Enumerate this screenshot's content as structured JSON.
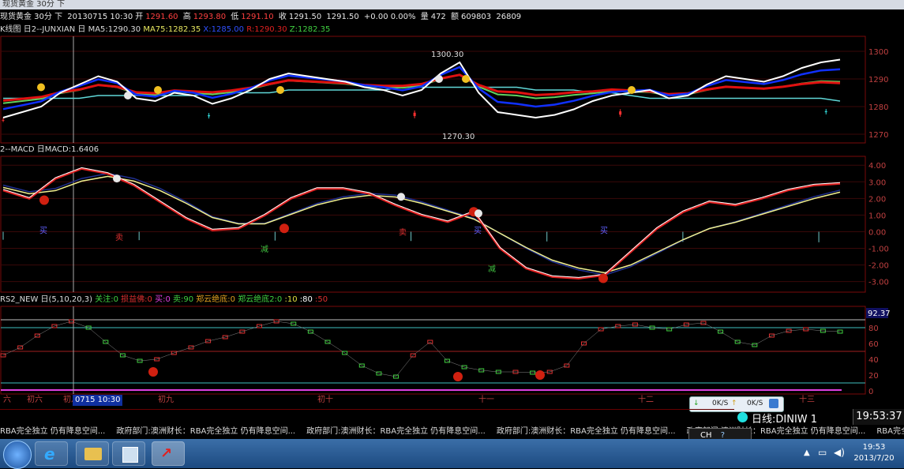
{
  "window": {
    "title": "现货黄金 30分 下"
  },
  "quote": {
    "symbol": "现货黄金 30分 下",
    "date": "20130715 10:30",
    "open_label": "开",
    "open": "1291.60",
    "high_label": "高",
    "high": "1293.80",
    "low_label": "低",
    "low": "1291.10",
    "close_label": "收",
    "close": "1291.50",
    "last": "1291.50",
    "change": "+0.00 0.00%",
    "vol_label": "量",
    "vol": "472",
    "amt_label": "额",
    "amt": "609803",
    "extra": "26809"
  },
  "pane_k": {
    "title": "K线图 日2--JUNXIAN 日",
    "ma5_label": "MA5:",
    "ma5": "1290.30",
    "ma75_label": "MA75:",
    "ma75": "1282.35",
    "x_label": "X:",
    "x": "1285.00",
    "r_label": "R:",
    "r": "1290.30",
    "z_label": "Z:",
    "z": "1282.35",
    "ann_high": "1300.30",
    "ann_low": "1270.30",
    "y_ticks": [
      "1300",
      "1290",
      "1280",
      "1270"
    ],
    "colors": {
      "up": "#ff3030",
      "down": "#30d0d0",
      "ma_white": "#ffffff",
      "ma_blue": "#1030ff",
      "ma_red": "#e01010",
      "ma_green": "#60d060",
      "ma_cyan": "#60d8d8"
    }
  },
  "pane_macd": {
    "title": "2--MACD 日",
    "macd_label": "MACD:",
    "macd": "1.6406",
    "y_ticks": [
      "4.00",
      "3.00",
      "2.00",
      "1.00",
      "0.00",
      "-1.00",
      "-2.00",
      "-3.00"
    ],
    "marks": [
      "买",
      "卖",
      "减",
      "卖",
      "减",
      "买",
      "买"
    ]
  },
  "pane_rs": {
    "title": "RS2_NEW 日(5,10,20,3)",
    "legend": [
      {
        "label": "关注:0",
        "color": "#40d040"
      },
      {
        "label": "损益佛:0",
        "color": "#e03030"
      },
      {
        "label": "买:0",
        "color": "#e040e0"
      },
      {
        "label": "卖:90",
        "color": "#40d040"
      },
      {
        "label": "郑云绝底:0",
        "color": "#e0a020"
      },
      {
        "label": "郑云绝底2:0",
        "color": "#40d040"
      },
      {
        "label": ":10",
        "color": "#e0e040"
      },
      {
        "label": ":80",
        "color": "#ffffff"
      },
      {
        "label": ":50",
        "color": "#e03030"
      }
    ],
    "y_ticks": [
      "80",
      "60",
      "40",
      "20",
      "0"
    ],
    "value_box": "92.37"
  },
  "x_axis": {
    "labels": [
      "六",
      "初六",
      "初八",
      "初九",
      "初十",
      "十一",
      "十二",
      "十三"
    ],
    "cursor": "0715 10:30"
  },
  "speed": {
    "down": "0K/S",
    "up": "0K/S"
  },
  "status": {
    "line": "日线:DINIW 1",
    "clock": "19:53:37"
  },
  "ticker": {
    "items": [
      "RBA完全独立 仍有降息空间...",
      "政府部门:澳洲财长：RBA完全独立 仍有降息空间...",
      "政府部门:澳洲财长：RBA完全独立 仍有降息空间...",
      "政府部门:澳洲财长：RBA完全独立 仍有降息空间...",
      "政府部门:澳洲财长：RBA完全独立 仍有降息空间...",
      "RBA完全独立 仍有降息空间...",
      "政府部门:澳洲财长：RBA完全独立 仍有降息空间..."
    ]
  },
  "taskbar": {
    "time": "19:53",
    "date": "2013/7/20",
    "ime": "CH"
  },
  "chart_data": [
    {
      "type": "line",
      "title": "K线图 日2--JUNXIAN",
      "ylim": [
        1268,
        1304
      ],
      "series": [
        {
          "name": "MA5",
          "values": [
            1276,
            1278,
            1280,
            1285,
            1288,
            1291,
            1289,
            1283,
            1282,
            1285,
            1284,
            1281,
            1283,
            1286,
            1290,
            1292,
            1291,
            1290,
            1289,
            1287,
            1286,
            1284,
            1286,
            1292,
            1296,
            1285,
            1278,
            1277,
            1276,
            1277,
            1279,
            1282,
            1284,
            1285,
            1286,
            1283,
            1284,
            1288,
            1291,
            1290,
            1289,
            1291,
            1294,
            1296,
            1297
          ]
        },
        {
          "name": "MA75",
          "values": [
            1283,
            1283,
            1283,
            1283,
            1283,
            1284,
            1284,
            1284,
            1284,
            1284,
            1284,
            1285,
            1285,
            1285,
            1285,
            1286,
            1286,
            1286,
            1286,
            1286,
            1286,
            1287,
            1287,
            1287,
            1287,
            1287,
            1287,
            1287,
            1286,
            1286,
            1286,
            1285,
            1285,
            1284,
            1283,
            1283,
            1283,
            1283,
            1283,
            1283,
            1283,
            1283,
            1283,
            1283,
            1282
          ]
        }
      ]
    },
    {
      "type": "line",
      "title": "2--MACD",
      "ylim": [
        -3,
        4
      ],
      "series": [
        {
          "name": "MACD",
          "values": [
            2.5,
            2.0,
            3.2,
            3.8,
            3.5,
            2.8,
            1.8,
            0.8,
            0.1,
            0.2,
            1.0,
            2.0,
            2.6,
            2.6,
            2.3,
            1.6,
            1.0,
            0.6,
            1.2,
            -1.0,
            -2.2,
            -2.7,
            -2.8,
            -2.6,
            -1.2,
            0.2,
            1.2,
            1.8,
            1.6,
            2.0,
            2.5,
            2.8,
            2.9
          ]
        },
        {
          "name": "DEA",
          "values": [
            2.8,
            2.4,
            2.6,
            3.2,
            3.5,
            3.2,
            2.6,
            1.8,
            0.9,
            0.5,
            0.5,
            1.1,
            1.7,
            2.1,
            2.3,
            2.2,
            1.8,
            1.3,
            0.8,
            -0.1,
            -1.0,
            -1.8,
            -2.3,
            -2.6,
            -2.1,
            -1.3,
            -0.5,
            0.2,
            0.6,
            1.1,
            1.6,
            2.1,
            2.5
          ]
        }
      ]
    },
    {
      "type": "line",
      "title": "RS2_NEW",
      "ylim": [
        0,
        100
      ],
      "series": [
        {
          "name": "RS",
          "values": [
            45,
            55,
            70,
            82,
            88,
            80,
            62,
            45,
            38,
            40,
            48,
            55,
            63,
            68,
            75,
            82,
            88,
            85,
            75,
            62,
            48,
            32,
            22,
            18,
            45,
            62,
            38,
            30,
            26,
            24,
            24,
            23,
            24,
            32,
            60,
            78,
            82,
            84,
            80,
            78,
            84,
            86,
            75,
            62,
            58,
            70,
            76,
            78,
            76,
            75
          ]
        }
      ]
    }
  ]
}
